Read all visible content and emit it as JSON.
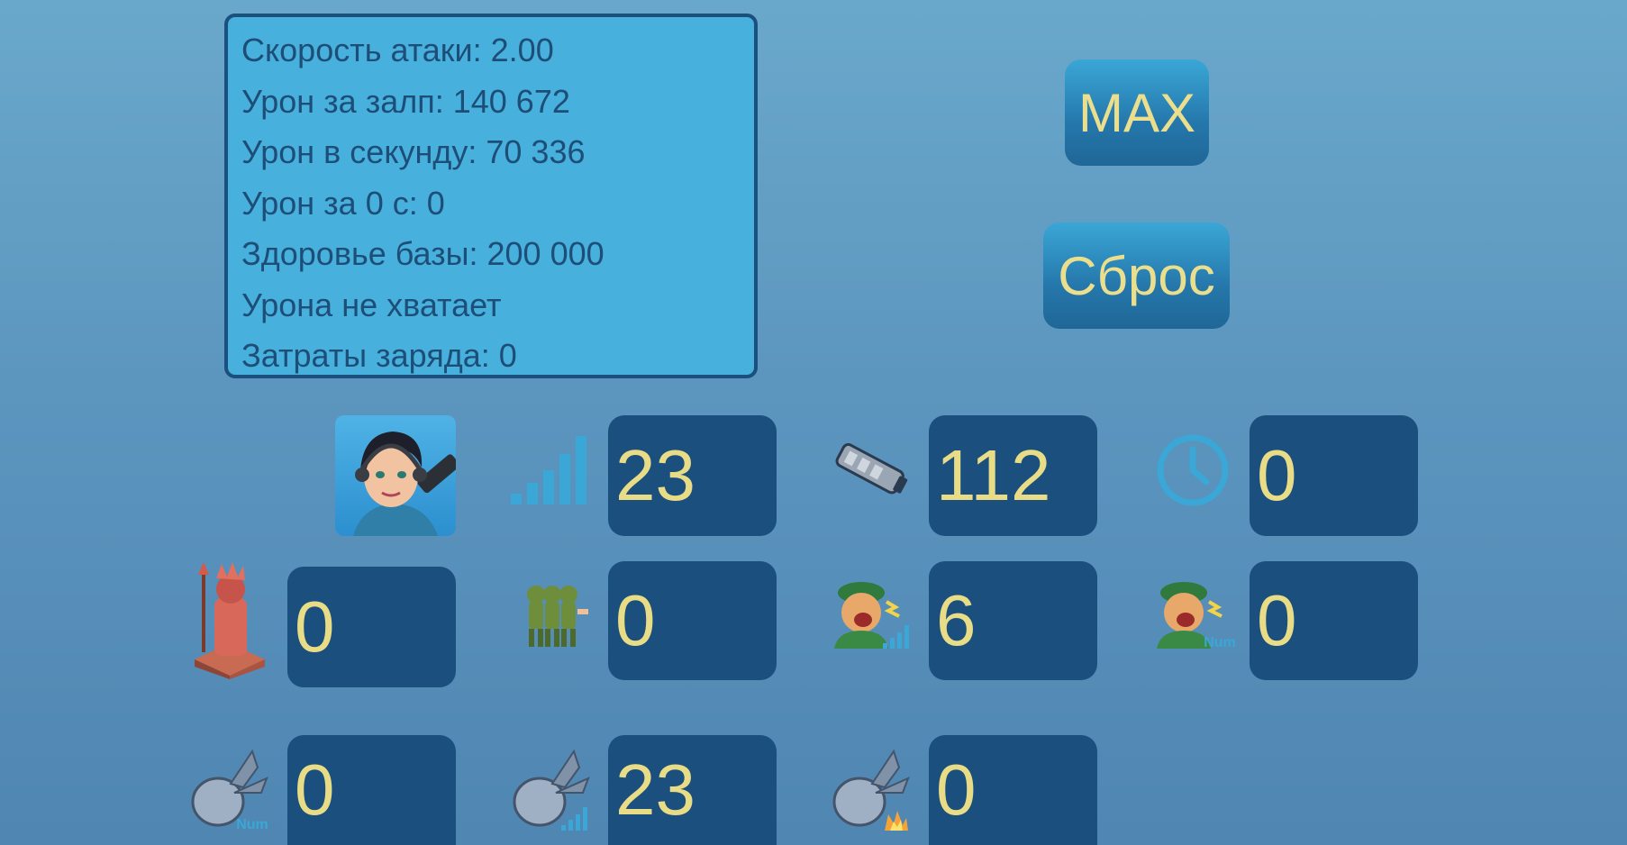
{
  "stats": {
    "lines": [
      "Скорость атаки: 2.00",
      "Урон за залп: 140 672",
      "Урон в секунду: 70 336",
      "Урон за 0 с: 0",
      "Здоровье базы: 200 000",
      "Урона не хватает",
      "Затраты заряда: 0"
    ]
  },
  "buttons": {
    "max": "MAX",
    "reset": "Сброс"
  },
  "fields": {
    "hero_level": "23",
    "weapon_power": "112",
    "time": "0",
    "statue": "0",
    "troops": "0",
    "screamer_level": "6",
    "screamer_count": "0",
    "bomb_count": "0",
    "bomb_level": "23",
    "bomb_damage": "0"
  },
  "badges": {
    "num": "Num"
  },
  "colors": {
    "panel": "#48b0dc",
    "panel_text": "#1d4e78",
    "value_box": "#1b4f7d",
    "value_text": "#e9dc86",
    "accent_icon": "#3aa7d6"
  },
  "icons": {
    "hero": "hero-portrait-icon",
    "level": "signal-bars-icon",
    "weapon": "flamethrower-weapon-icon",
    "time": "clock-icon",
    "statue": "statue-icon",
    "troops": "running-soldiers-icon",
    "screamer_level": "screamer-level-icon",
    "screamer_count": "screamer-count-icon",
    "bomb_count": "bomb-count-icon",
    "bomb_level": "bomb-level-icon",
    "bomb_damage": "bomb-damage-icon"
  }
}
